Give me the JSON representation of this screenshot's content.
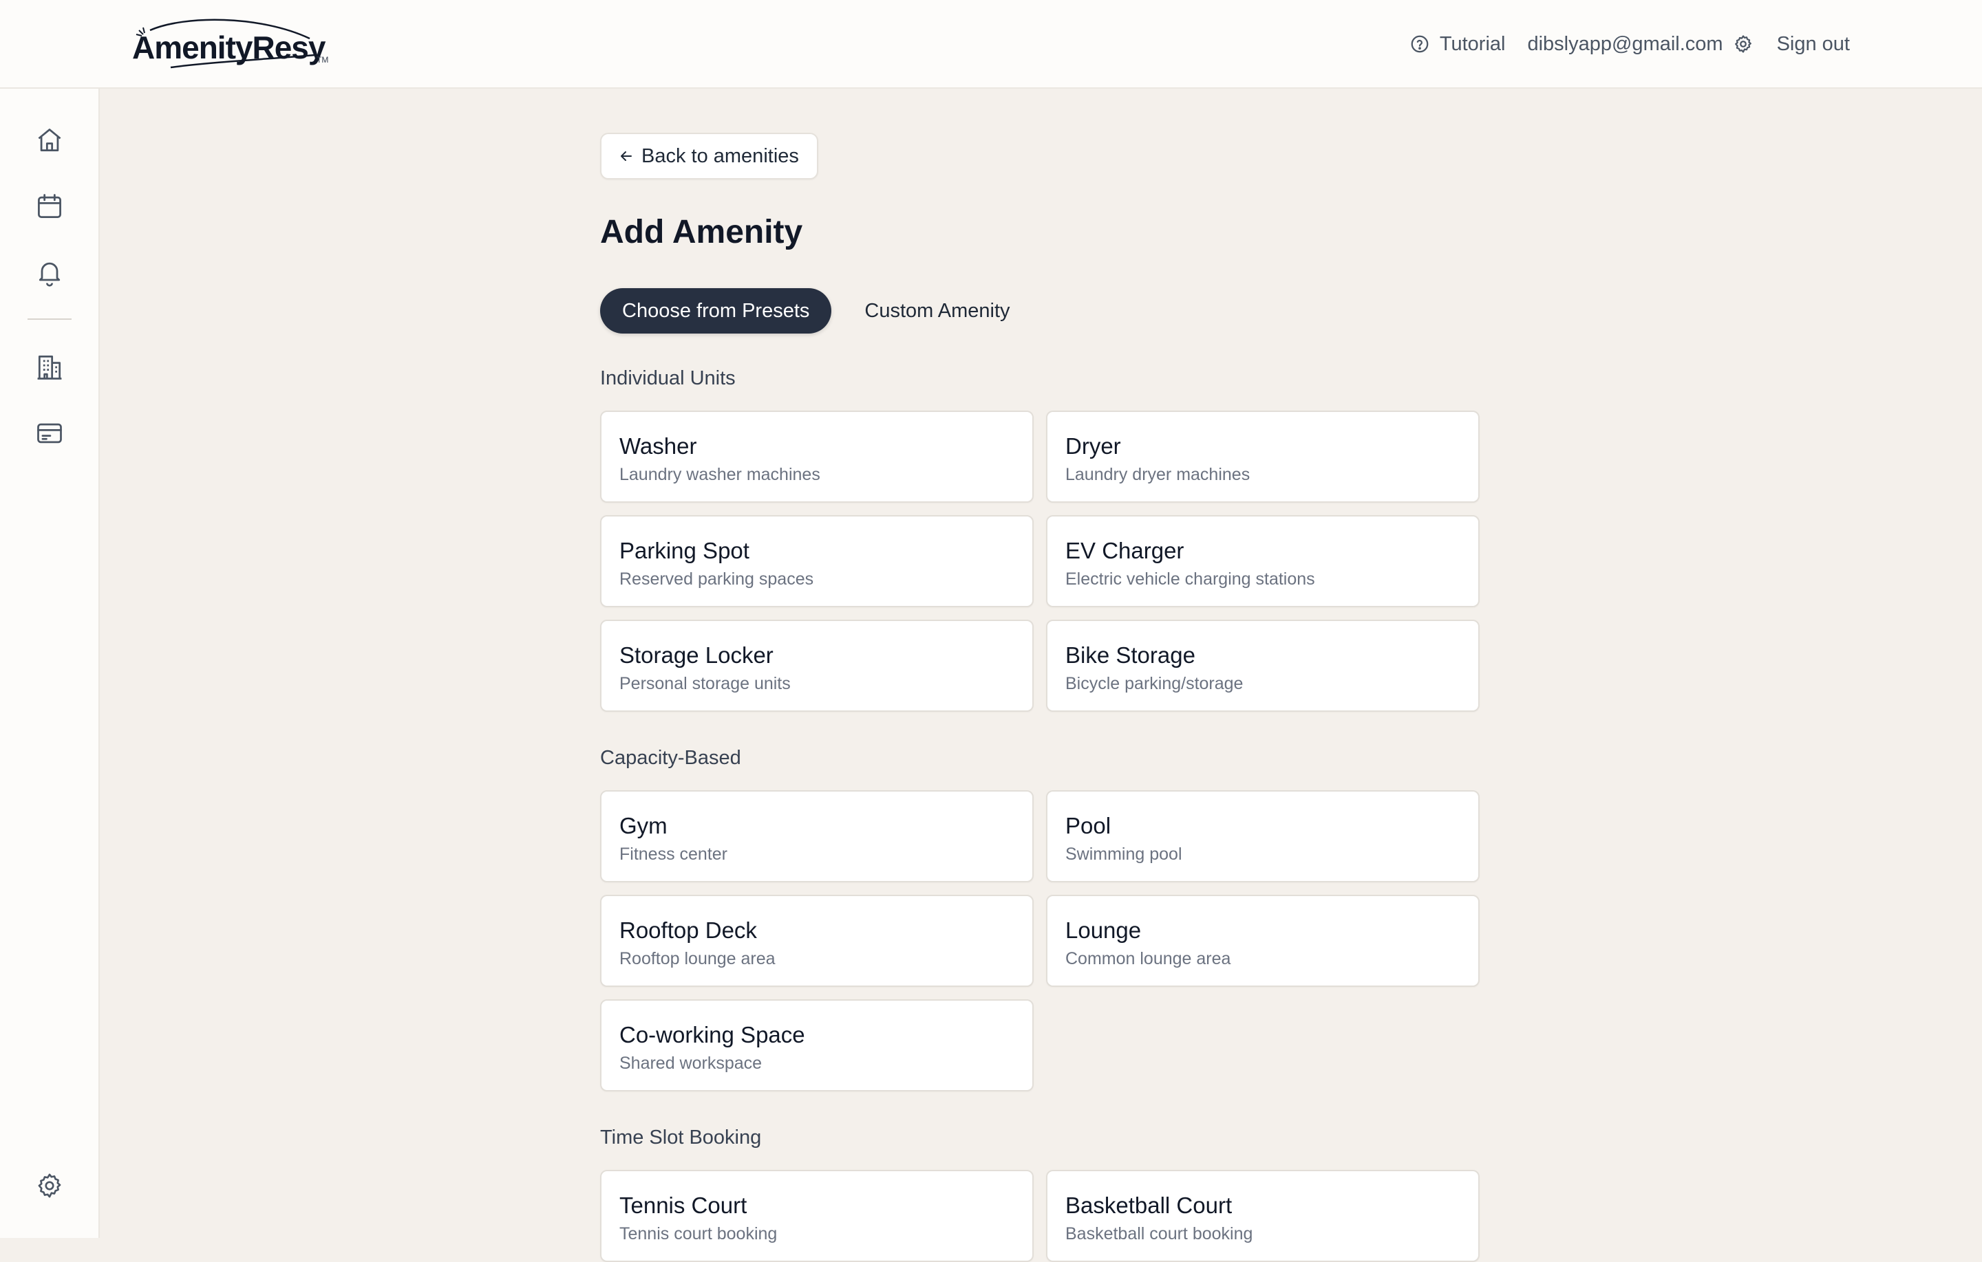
{
  "header": {
    "logo_text": "AmenityResy",
    "logo_tm": "TM",
    "tutorial_label": "Tutorial",
    "email": "dibslyapp@gmail.com",
    "sign_out_label": "Sign out"
  },
  "sidebar": {
    "items": [
      {
        "icon": "home-icon"
      },
      {
        "icon": "calendar-icon"
      },
      {
        "icon": "bell-icon"
      },
      {
        "icon": "building-icon"
      },
      {
        "icon": "credit-card-icon"
      },
      {
        "icon": "gear-icon"
      }
    ]
  },
  "main": {
    "back_label": "Back to amenities",
    "title": "Add Amenity",
    "tabs": [
      {
        "label": "Choose from Presets",
        "active": true
      },
      {
        "label": "Custom Amenity",
        "active": false
      }
    ],
    "sections": [
      {
        "title": "Individual Units",
        "cards": [
          {
            "title": "Washer",
            "desc": "Laundry washer machines"
          },
          {
            "title": "Dryer",
            "desc": "Laundry dryer machines"
          },
          {
            "title": "Parking Spot",
            "desc": "Reserved parking spaces"
          },
          {
            "title": "EV Charger",
            "desc": "Electric vehicle charging stations"
          },
          {
            "title": "Storage Locker",
            "desc": "Personal storage units"
          },
          {
            "title": "Bike Storage",
            "desc": "Bicycle parking/storage"
          }
        ]
      },
      {
        "title": "Capacity-Based",
        "cards": [
          {
            "title": "Gym",
            "desc": "Fitness center"
          },
          {
            "title": "Pool",
            "desc": "Swimming pool"
          },
          {
            "title": "Rooftop Deck",
            "desc": "Rooftop lounge area"
          },
          {
            "title": "Lounge",
            "desc": "Common lounge area"
          },
          {
            "title": "Co-working Space",
            "desc": "Shared workspace"
          }
        ]
      },
      {
        "title": "Time Slot Booking",
        "cards": [
          {
            "title": "Tennis Court",
            "desc": "Tennis court booking"
          },
          {
            "title": "Basketball Court",
            "desc": "Basketball court booking"
          }
        ]
      }
    ]
  },
  "colors": {
    "page_bg": "#f4f0eb",
    "active_tab_bg": "#273041",
    "card_bg": "#ffffff"
  }
}
